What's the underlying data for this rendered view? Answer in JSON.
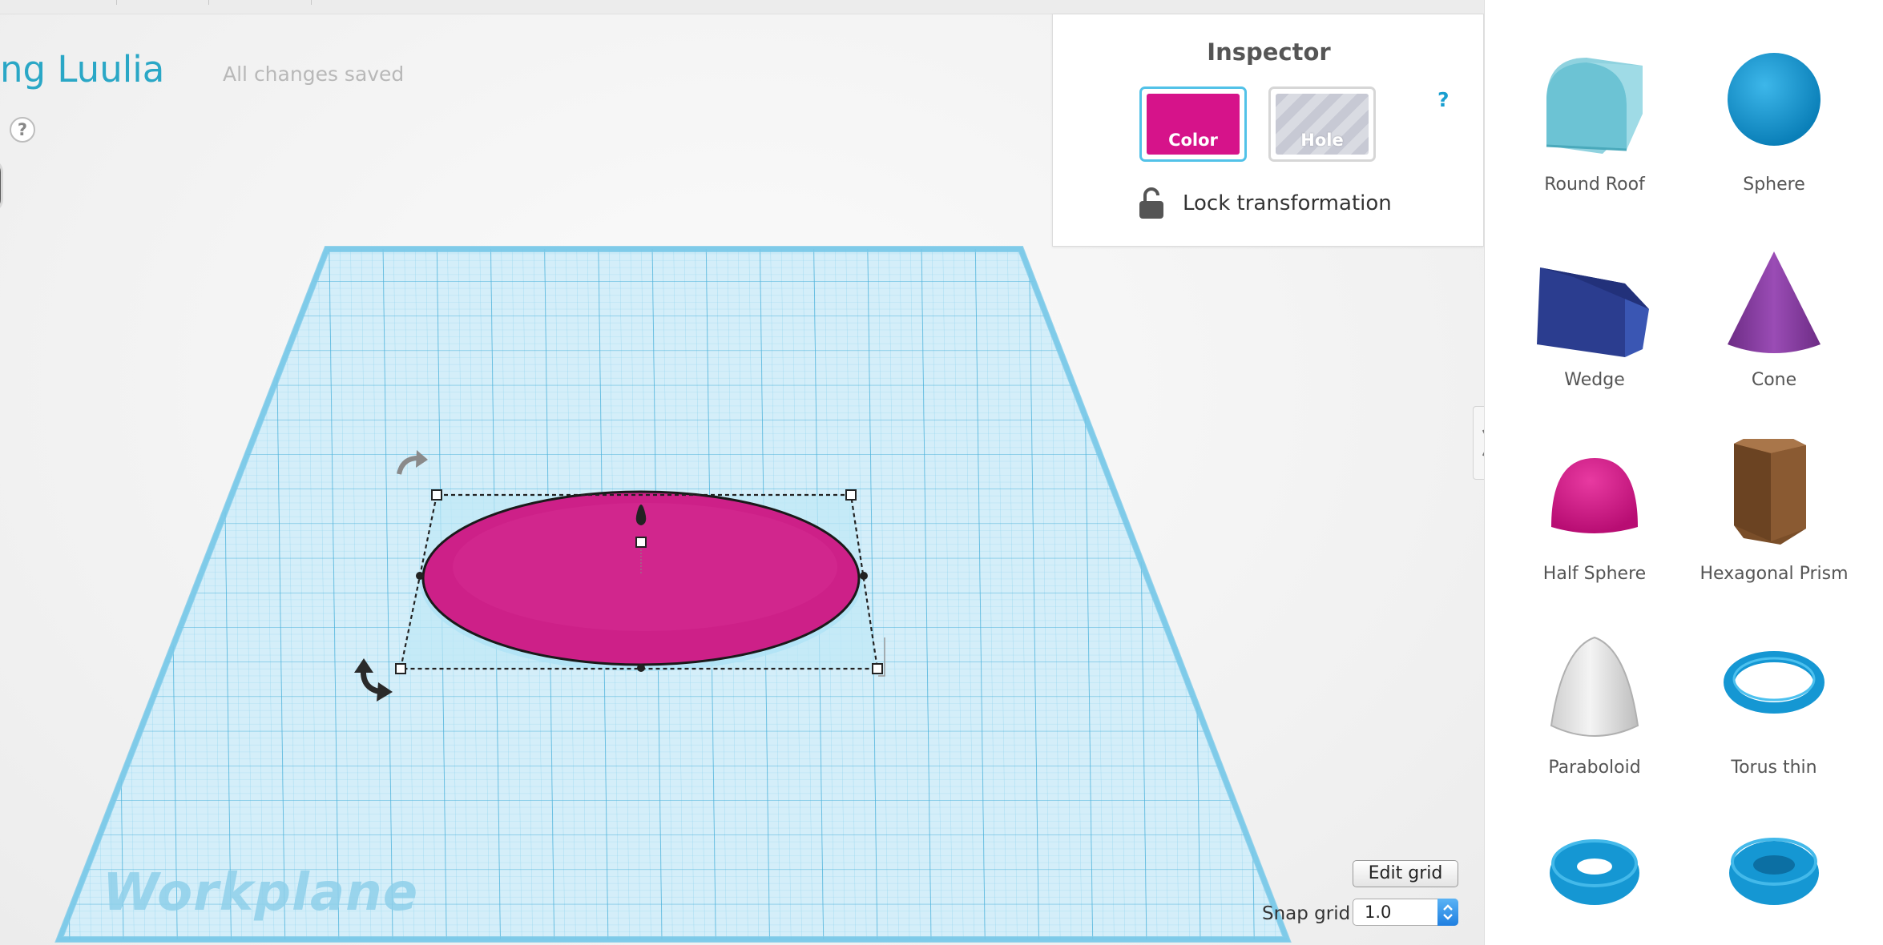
{
  "project": {
    "title": "ng Luulia",
    "save_status": "All changes saved",
    "help_glyph": "?"
  },
  "workplane": {
    "label": "Workplane",
    "grid_color": "#5fc0e4"
  },
  "selected_shape": {
    "name": "Half Sphere",
    "color": "#d6138a"
  },
  "inspector": {
    "title": "Inspector",
    "color_button": "Color",
    "hole_button": "Hole",
    "help": "?",
    "lock_label": "Lock transformation",
    "lock_icon": "unlocked-padlock-icon",
    "accent_color": "#52c2e8"
  },
  "grid_controls": {
    "edit_grid_label": "Edit grid",
    "snap_label": "Snap grid",
    "snap_value": "1.0"
  },
  "shapes": [
    {
      "label": "Round Roof",
      "icon": "round-roof-icon",
      "color": "#6cc3d4"
    },
    {
      "label": "Sphere",
      "icon": "sphere-icon",
      "color": "#1597d3"
    },
    {
      "label": "Wedge",
      "icon": "wedge-icon",
      "color": "#2b3d8f"
    },
    {
      "label": "Cone",
      "icon": "cone-icon",
      "color": "#8a3fa3"
    },
    {
      "label": "Half Sphere",
      "icon": "half-sphere-icon",
      "color": "#d6138a"
    },
    {
      "label": "Hexagonal Prism",
      "icon": "hexagonal-prism-icon",
      "color": "#8a5a32"
    },
    {
      "label": "Paraboloid",
      "icon": "paraboloid-icon",
      "color": "#e6e6e6"
    },
    {
      "label": "Torus thin",
      "icon": "torus-thin-icon",
      "color": "#1597d3"
    },
    {
      "label": "",
      "icon": "torus-icon",
      "color": "#1597d3"
    },
    {
      "label": "",
      "icon": "tube-icon",
      "color": "#1597d3"
    }
  ]
}
